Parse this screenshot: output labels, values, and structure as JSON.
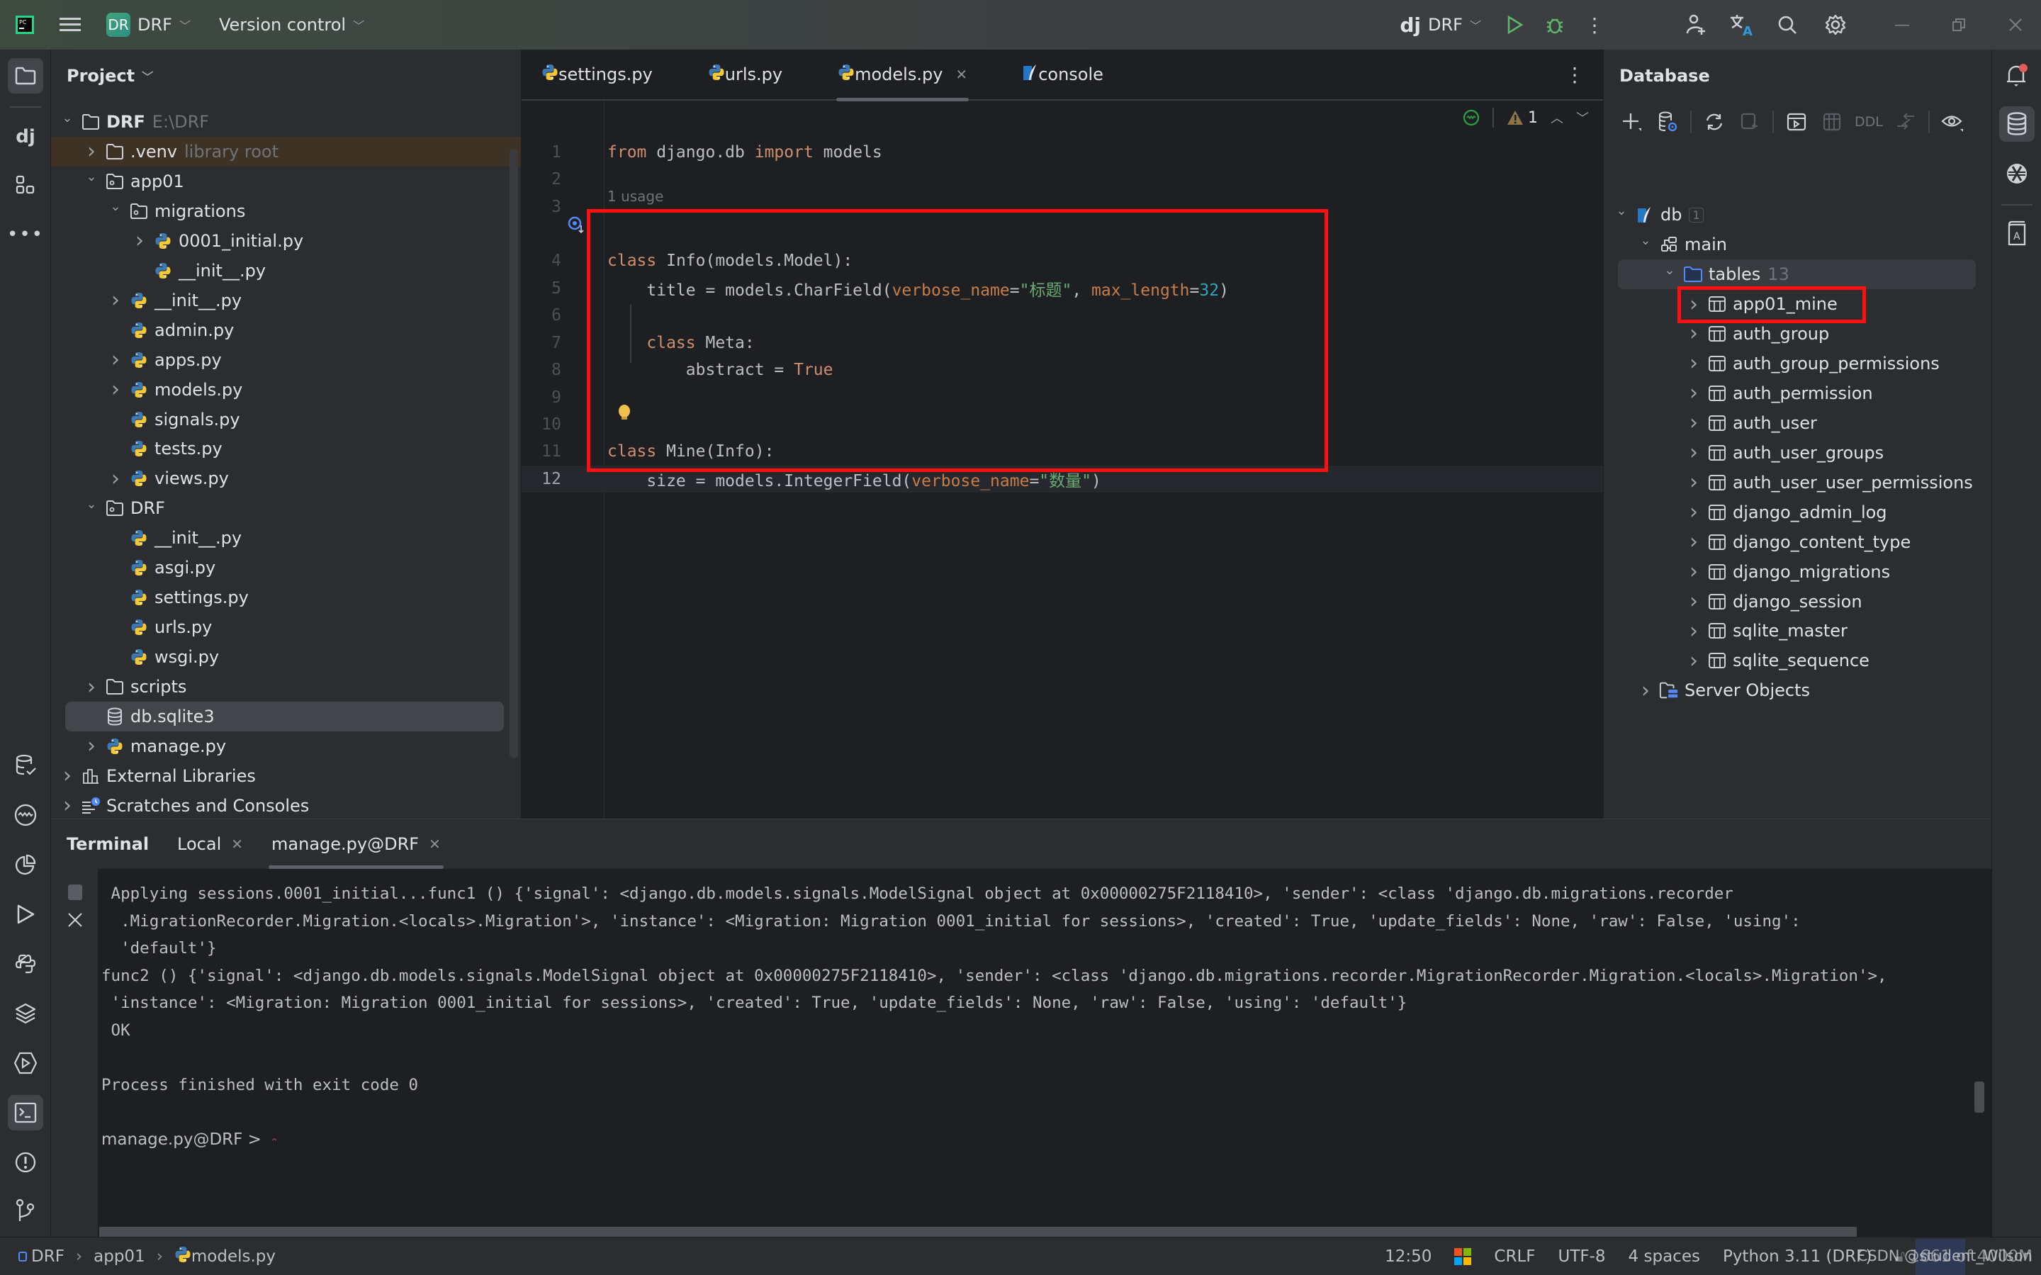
{
  "titlebar": {
    "app_logo": "PyCharm",
    "project_badge": "DR",
    "project_name": "DRF",
    "vcs_label": "Version control",
    "run_config_prefix": "dj",
    "run_config": "DRF"
  },
  "project_panel": {
    "title": "Project",
    "tree": [
      {
        "label": "DRF",
        "hint": "E:\\DRF",
        "indent": 0,
        "arrow": "open",
        "icon": "folder",
        "bold": true
      },
      {
        "label": ".venv",
        "hint": "library root",
        "indent": 1,
        "arrow": "closed",
        "icon": "folder",
        "highlight": "venv"
      },
      {
        "label": "app01",
        "indent": 1,
        "arrow": "open",
        "icon": "package"
      },
      {
        "label": "migrations",
        "indent": 2,
        "arrow": "open",
        "icon": "package"
      },
      {
        "label": "0001_initial.py",
        "indent": 3,
        "arrow": "closed",
        "icon": "python"
      },
      {
        "label": "__init__.py",
        "indent": 3,
        "arrow": "none",
        "icon": "python"
      },
      {
        "label": "__init__.py",
        "indent": 2,
        "arrow": "closed",
        "icon": "python"
      },
      {
        "label": "admin.py",
        "indent": 2,
        "arrow": "none",
        "icon": "python"
      },
      {
        "label": "apps.py",
        "indent": 2,
        "arrow": "closed",
        "icon": "python"
      },
      {
        "label": "models.py",
        "indent": 2,
        "arrow": "closed",
        "icon": "python"
      },
      {
        "label": "signals.py",
        "indent": 2,
        "arrow": "none",
        "icon": "python"
      },
      {
        "label": "tests.py",
        "indent": 2,
        "arrow": "none",
        "icon": "python"
      },
      {
        "label": "views.py",
        "indent": 2,
        "arrow": "closed",
        "icon": "python"
      },
      {
        "label": "DRF",
        "indent": 1,
        "arrow": "open",
        "icon": "package"
      },
      {
        "label": "__init__.py",
        "indent": 2,
        "arrow": "none",
        "icon": "python"
      },
      {
        "label": "asgi.py",
        "indent": 2,
        "arrow": "none",
        "icon": "python"
      },
      {
        "label": "settings.py",
        "indent": 2,
        "arrow": "none",
        "icon": "python"
      },
      {
        "label": "urls.py",
        "indent": 2,
        "arrow": "none",
        "icon": "python"
      },
      {
        "label": "wsgi.py",
        "indent": 2,
        "arrow": "none",
        "icon": "python"
      },
      {
        "label": "scripts",
        "indent": 1,
        "arrow": "closed",
        "icon": "folder"
      },
      {
        "label": "db.sqlite3",
        "indent": 1,
        "arrow": "none",
        "icon": "database",
        "highlight": "selected"
      },
      {
        "label": "manage.py",
        "indent": 1,
        "arrow": "closed",
        "icon": "python"
      },
      {
        "label": "External Libraries",
        "indent": 0,
        "arrow": "closed",
        "icon": "library"
      },
      {
        "label": "Scratches and Consoles",
        "indent": 0,
        "arrow": "closed",
        "icon": "scratches"
      }
    ]
  },
  "editor": {
    "tabs": [
      {
        "label": "settings.py",
        "icon": "python",
        "active": false,
        "closable": false
      },
      {
        "label": "urls.py",
        "icon": "python",
        "active": false,
        "closable": false
      },
      {
        "label": "models.py",
        "icon": "python",
        "active": true,
        "closable": true
      },
      {
        "label": "console",
        "icon": "sqlite",
        "active": false,
        "closable": false
      }
    ],
    "inspection": {
      "warnings": "1"
    },
    "usage_hint": "1 usage",
    "current_line": 12,
    "lines": [
      {
        "n": "1",
        "tokens": [
          [
            "kw",
            "from"
          ],
          [
            "t",
            " django.db "
          ],
          [
            "kw",
            "import"
          ],
          [
            "t",
            " models"
          ]
        ]
      },
      {
        "n": "2",
        "tokens": []
      },
      {
        "n": "3",
        "tokens": []
      },
      {
        "n": "4",
        "tokens": [
          [
            "kw",
            "class"
          ],
          [
            "t",
            " Info(models.Model):"
          ]
        ]
      },
      {
        "n": "5",
        "tokens": [
          [
            "t",
            "    title = models.CharField("
          ],
          [
            "param",
            "verbose_name"
          ],
          [
            "t",
            "="
          ],
          [
            "str",
            "\"标题\""
          ],
          [
            "t",
            ", "
          ],
          [
            "param",
            "max_length"
          ],
          [
            "t",
            "="
          ],
          [
            "num",
            "32"
          ],
          [
            "t",
            ")"
          ]
        ]
      },
      {
        "n": "6",
        "tokens": []
      },
      {
        "n": "7",
        "tokens": [
          [
            "t",
            "    "
          ],
          [
            "kw",
            "class"
          ],
          [
            "t",
            " Meta:"
          ]
        ]
      },
      {
        "n": "8",
        "tokens": [
          [
            "t",
            "        abstract = "
          ],
          [
            "kw",
            "True"
          ]
        ]
      },
      {
        "n": "9",
        "tokens": []
      },
      {
        "n": "10",
        "tokens": []
      },
      {
        "n": "11",
        "tokens": [
          [
            "kw",
            "class"
          ],
          [
            "t",
            " Mine(Info):"
          ]
        ]
      },
      {
        "n": "12",
        "tokens": [
          [
            "t",
            "    size = models.IntegerField("
          ],
          [
            "param",
            "verbose_name"
          ],
          [
            "t",
            "="
          ],
          [
            "str",
            "\"数量\""
          ],
          [
            "t",
            ")"
          ]
        ]
      }
    ]
  },
  "database_panel": {
    "title": "Database",
    "toolbar": [
      "add",
      "data-source-properties",
      "refresh",
      "disconnect",
      "console",
      "table-editor",
      "DDL",
      "compare",
      "view-options"
    ],
    "ddl_label": "DDL",
    "db_name": "db",
    "db_count": "1",
    "schema": "main",
    "tables_label": "tables",
    "tables_count": "13",
    "tables": [
      "app01_mine",
      "auth_group",
      "auth_group_permissions",
      "auth_permission",
      "auth_user",
      "auth_user_groups",
      "auth_user_user_permissions",
      "django_admin_log",
      "django_content_type",
      "django_migrations",
      "django_session",
      "sqlite_master",
      "sqlite_sequence"
    ],
    "server_objects": "Server Objects"
  },
  "terminal": {
    "title": "Terminal",
    "tabs": [
      {
        "label": "Local",
        "active": false
      },
      {
        "label": "manage.py@DRF",
        "active": true
      }
    ],
    "lines": [
      " Applying sessions.0001_initial...func1 () {'signal': <django.db.models.signals.ModelSignal object at 0x00000275F2118410>, 'sender': <class 'django.db.migrations.recorder",
      "  .MigrationRecorder.Migration.<locals>.Migration'>, 'instance': <Migration: Migration 0001_initial for sessions>, 'created': True, 'update_fields': None, 'raw': False, 'using':",
      "  'default'}",
      "func2 () {'signal': <django.db.models.signals.ModelSignal object at 0x00000275F2118410>, 'sender': <class 'django.db.migrations.recorder.MigrationRecorder.Migration.<locals>.Migration'>,",
      " 'instance': <Migration: Migration 0001_initial for sessions>, 'created': True, 'update_fields': None, 'raw': False, 'using': 'default'}",
      " OK",
      "",
      "Process finished with exit code 0",
      "",
      "manage.py@DRF > "
    ]
  },
  "statusbar": {
    "breadcrumb": [
      "DRF",
      "app01",
      "models.py"
    ],
    "position": "12:50",
    "line_ending": "CRLF",
    "encoding": "UTF-8",
    "indent": "4 spaces",
    "interpreter": "Python 3.11 (DRF)",
    "memory": "1661 of 4000M",
    "watermark": "CSDN @student_Wilson"
  },
  "colors": {
    "accent_red_box": "#ff1010",
    "keyword": "#cf8e6d",
    "string": "#6aab73",
    "number": "#2aacb8",
    "param": "#c77d48"
  }
}
